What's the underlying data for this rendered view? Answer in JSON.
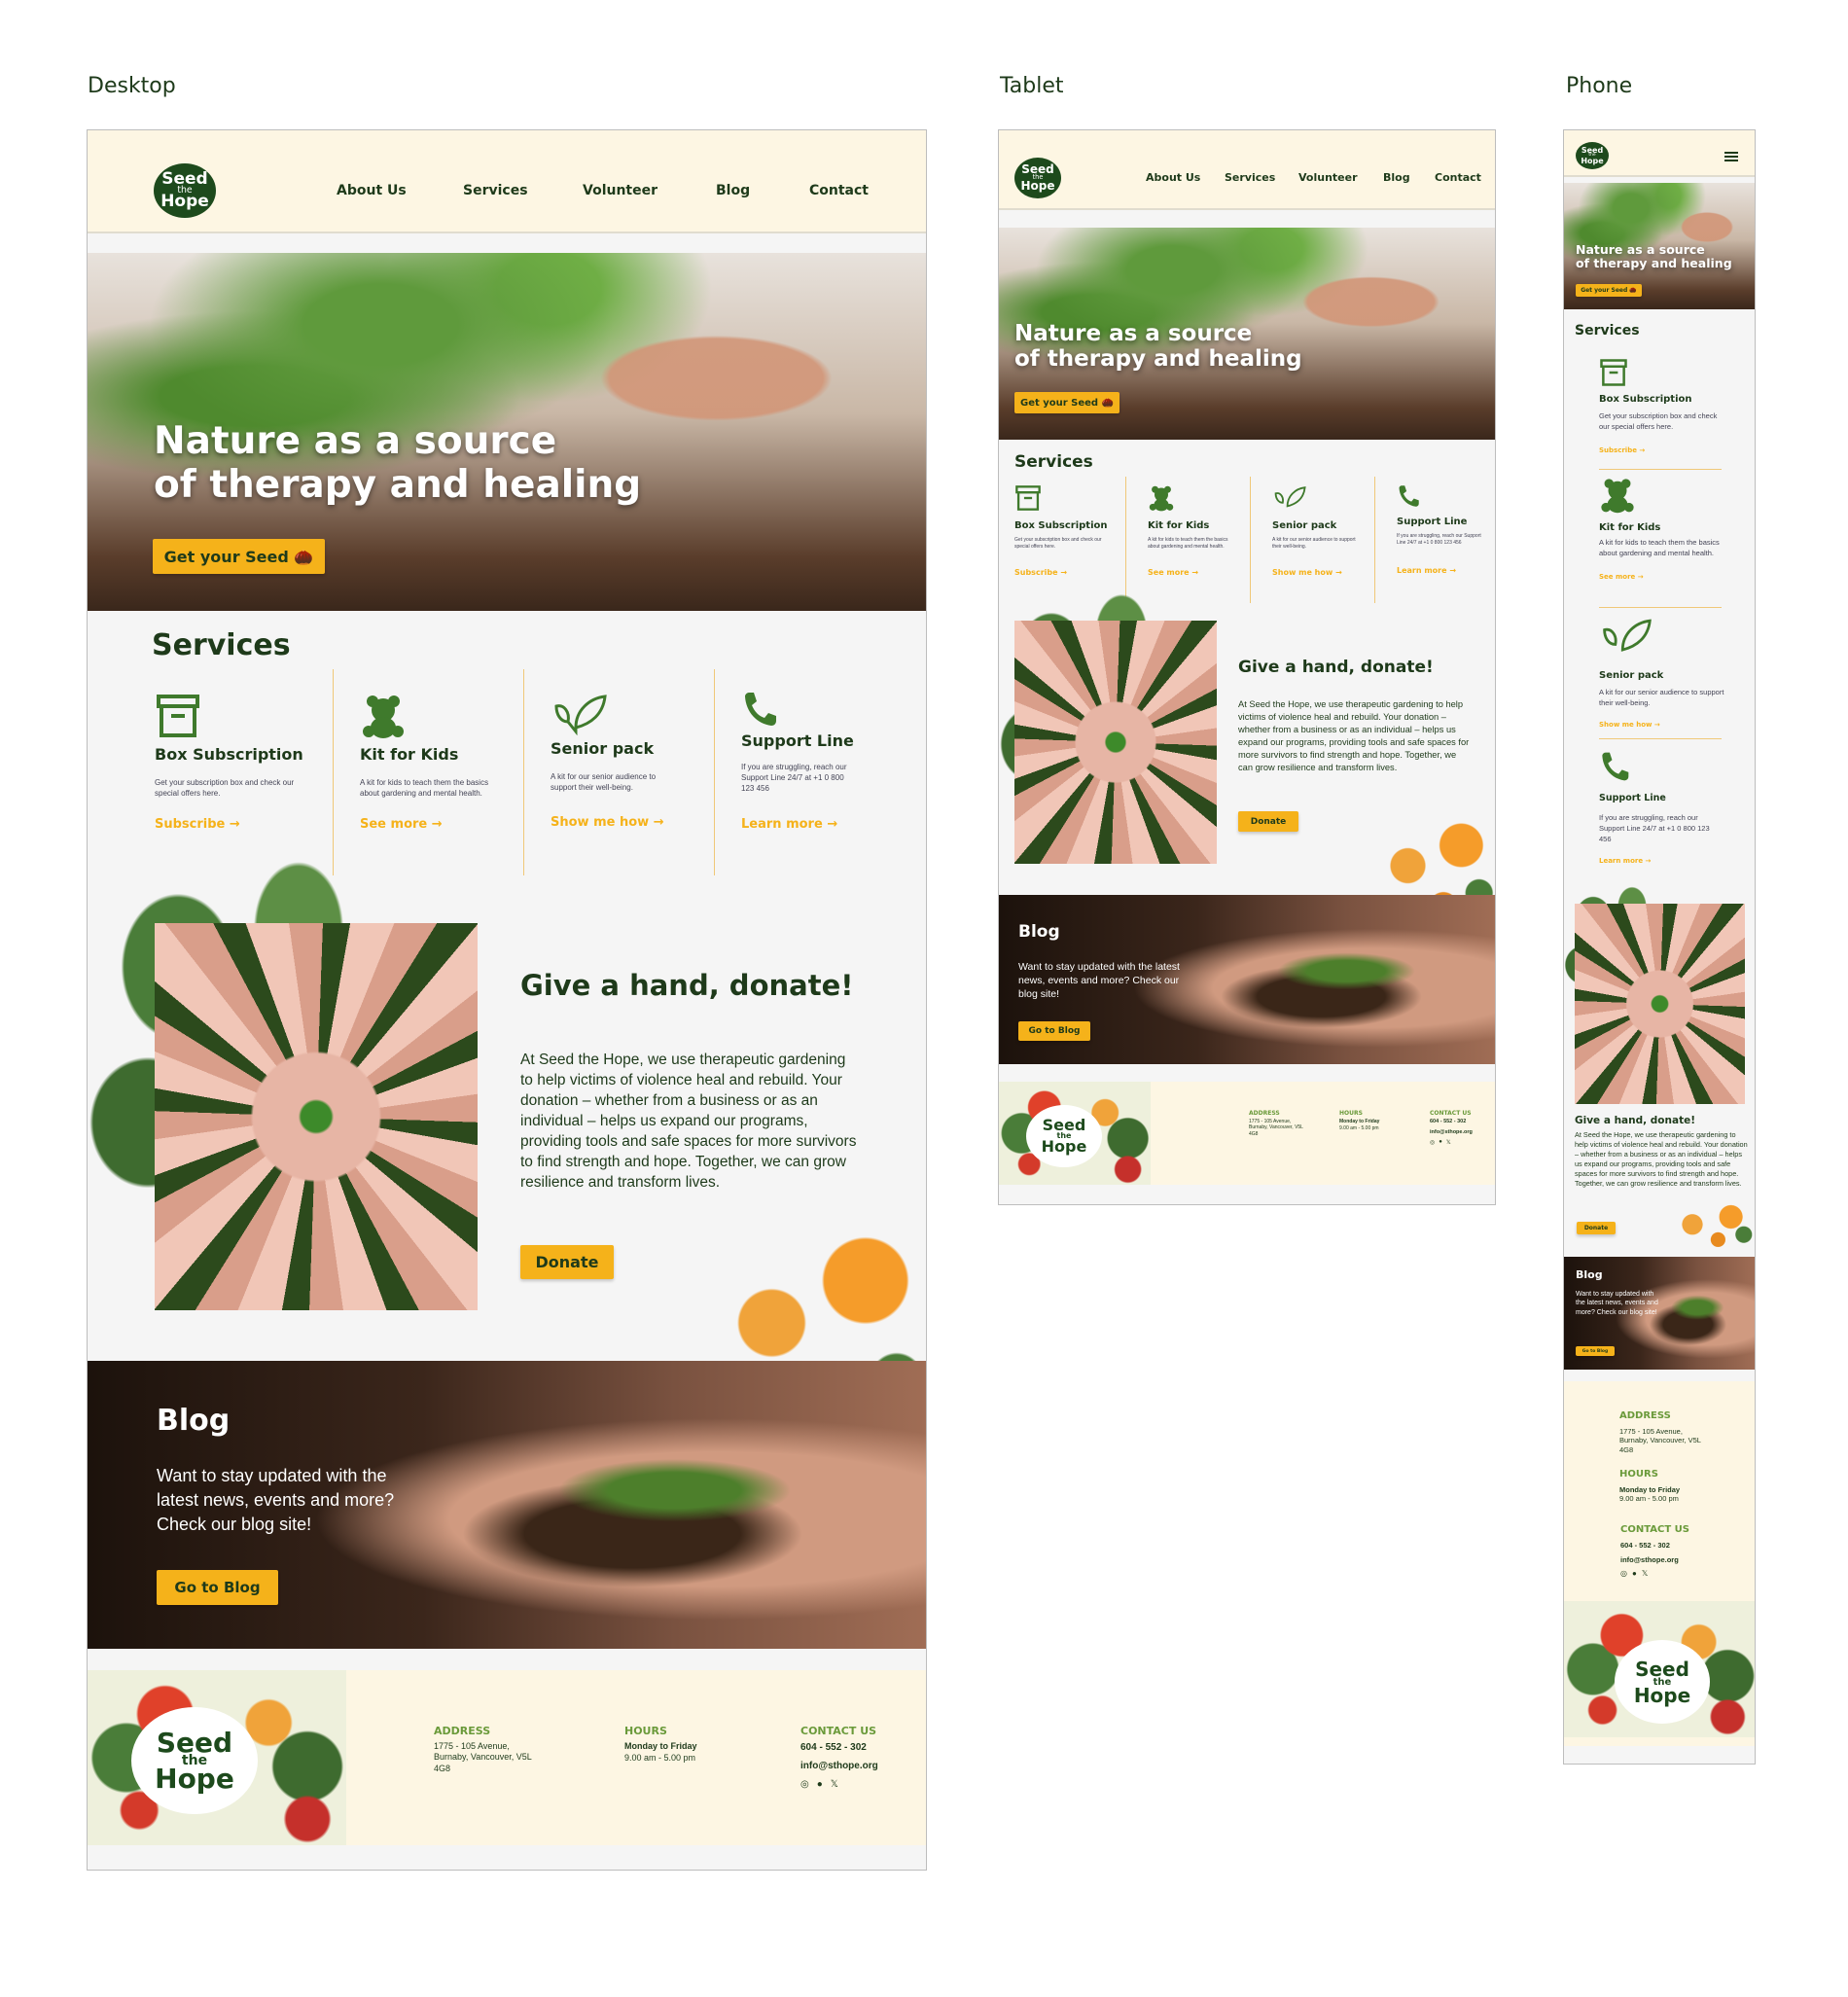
{
  "frames": {
    "desktop": "Desktop",
    "tablet": "Tablet",
    "phone": "Phone"
  },
  "brand": {
    "line1": "Seed",
    "line2": "the",
    "line3": "Hope"
  },
  "nav": [
    "About Us",
    "Services",
    "Volunteer",
    "Blog",
    "Contact"
  ],
  "hero": {
    "line1": "Nature as a source",
    "line2": "of therapy and healing",
    "cta": "Get your Seed 🌰"
  },
  "services": {
    "title": "Services",
    "items": [
      {
        "name": "Box Subscription",
        "desc": "Get your subscription box and check our special offers here.",
        "link": "Subscribe",
        "icon": "box-icon"
      },
      {
        "name": "Kit for Kids",
        "desc": "A kit for kids to teach them the basics about gardening and mental health.",
        "link": "See more",
        "icon": "teddy-bear-icon"
      },
      {
        "name": "Senior pack",
        "desc": "A kit for our senior audience to support their well-being.",
        "link": "Show me how",
        "icon": "leaf-icon"
      },
      {
        "name": "Support Line",
        "desc": "If you are struggling, reach our Support Line 24/7 at +1 0 800 123 456",
        "link": "Learn more",
        "icon": "phone-icon"
      }
    ],
    "arrow": "→"
  },
  "donate": {
    "title": "Give a hand, donate!",
    "body": "At Seed the Hope, we use therapeutic gardening to help victims of violence heal and rebuild. Your donation – whether from a business or as an individual – helps us expand our programs, providing tools and safe spaces for more survivors to find strength and hope. Together, we can grow resilience and transform lives.",
    "cta": "Donate"
  },
  "blog": {
    "title": "Blog",
    "desc": "Want to stay updated with the latest news, events and more? Check our blog site!",
    "cta": "Go to Blog"
  },
  "footer": {
    "address_h": "ADDRESS",
    "address": "1775 - 105 Avenue, Burnaby, Vancouver, V5L 4G8",
    "hours_h": "HOURS",
    "hours_days": "Monday to Friday",
    "hours_time": "9.00 am - 5.00 pm",
    "contact_h": "CONTACT US",
    "phone": "604 - 552 - 302",
    "email": "info@sthope.org",
    "socials": [
      "instagram-icon",
      "facebook-icon",
      "x-icon"
    ],
    "social_glyphs": [
      "◎",
      "●",
      "𝕏"
    ]
  },
  "colors": {
    "dark_green": "#1d4a1c",
    "accent": "#f5b21a",
    "cream": "#fdf6e3",
    "leaf": "#3f7a2c"
  }
}
